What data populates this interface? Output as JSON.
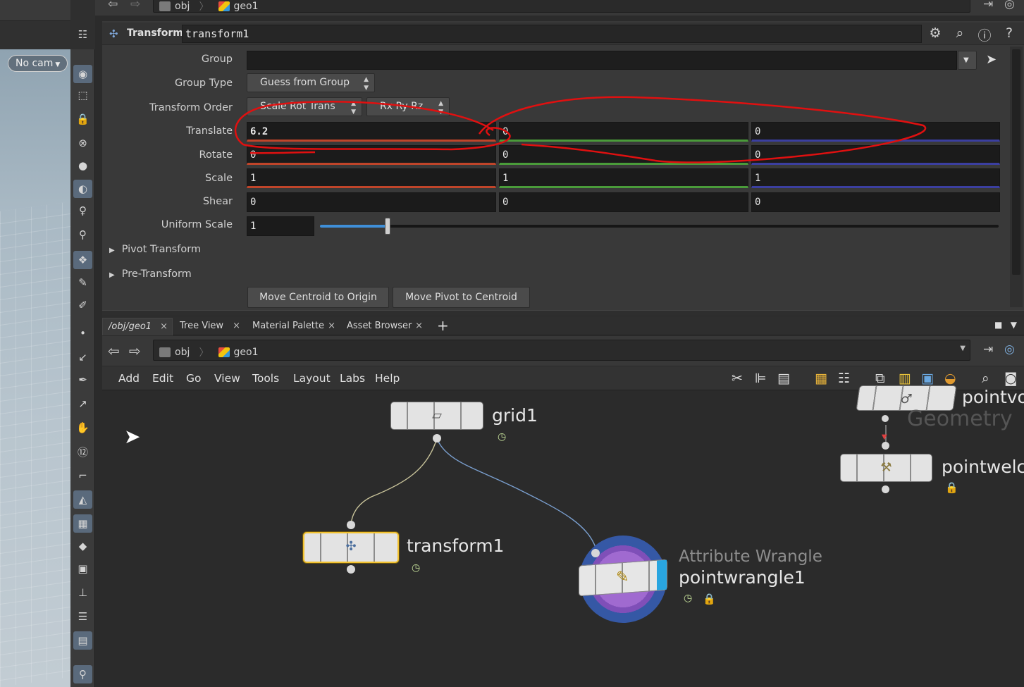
{
  "viewport": {
    "camera_label": "No cam"
  },
  "topbar": {
    "crumbs": [
      "obj",
      "geo1"
    ]
  },
  "params": {
    "node_type": "Transform",
    "node_name": "transform1",
    "group_label": "Group",
    "group_value": "",
    "group_type_label": "Group Type",
    "group_type_value": "Guess from Group",
    "transform_order_label": "Transform Order",
    "transform_order_value": "Scale Rot Trans",
    "rotate_order_value": "Rx Ry Rz",
    "translate_label": "Translate",
    "translate": [
      "6.2",
      "0",
      "0"
    ],
    "rotate_label": "Rotate",
    "rotate": [
      "0",
      "0",
      "0"
    ],
    "scale_label": "Scale",
    "scale": [
      "1",
      "1",
      "1"
    ],
    "shear_label": "Shear",
    "shear": [
      "0",
      "0",
      "0"
    ],
    "uniform_scale_label": "Uniform Scale",
    "uniform_scale": "1",
    "uniform_scale_slider_fraction": 0.1,
    "folders": [
      "Pivot Transform",
      "Pre-Transform"
    ],
    "buttons": [
      "Move Centroid to Origin",
      "Move Pivot to Centroid"
    ]
  },
  "network": {
    "tabs": [
      "/obj/geo1",
      "Tree View",
      "Material Palette",
      "Asset Browser"
    ],
    "crumbs": [
      "obj",
      "geo1"
    ],
    "menu": [
      "Add",
      "Edit",
      "Go",
      "View",
      "Tools",
      "Layout",
      "Labs",
      "Help"
    ],
    "nodes": {
      "grid": "grid1",
      "transform": "transform1",
      "wrangle_type": "Attribute Wrangle",
      "wrangle": "pointwrangle1",
      "pointvop_partial": "pointvo",
      "pointweld_partial": "pointwelc",
      "geometry_partial": "Geometry"
    }
  },
  "colors": {
    "x_axis": "#c0452a",
    "y_axis": "#4a9b3a",
    "z_axis": "#3b3fa0",
    "annotation": "#e01010",
    "selected_node": "#f2c230"
  }
}
